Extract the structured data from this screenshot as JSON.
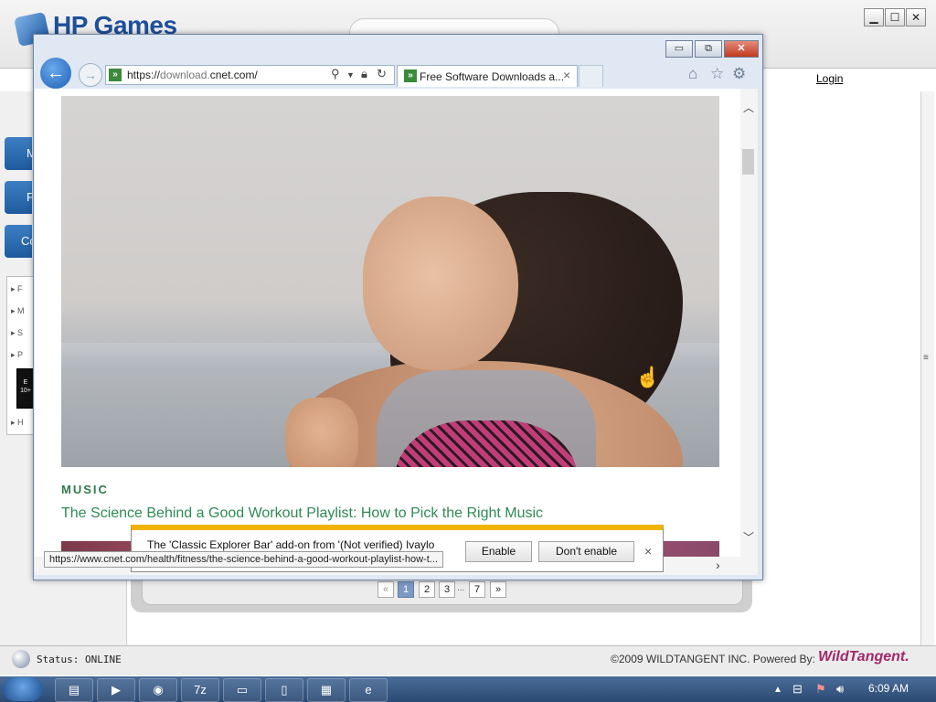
{
  "hp_window": {
    "logo_text": "HP Games",
    "login_label": "Login",
    "window_min": "▁",
    "window_max": "☐",
    "window_close": "✕",
    "nav_tabs": [
      "M",
      "F",
      "Co"
    ],
    "left_list_items": [
      "▸ F",
      "▸ M",
      "▸ S",
      "▸ P",
      "▸ H"
    ],
    "esrb_label": "E 10+",
    "pagination": {
      "prev": "«",
      "pages": [
        "1",
        "2",
        "3"
      ],
      "ellipsis": "...",
      "last": "7",
      "next": "»",
      "active": "1"
    },
    "status_text": "Status: ONLINE",
    "copyright": "©2009 WILDTANGENT INC. Powered By:",
    "brand": "WildTangent."
  },
  "ie_window": {
    "buttons": {
      "minimize": "▭",
      "restore": "⧉",
      "close": "✕"
    },
    "back_icon": "←",
    "forward_icon": "→",
    "address_url_host": "https://",
    "address_url_dim": "download.",
    "address_url_main": "cnet.com/",
    "favicon": "»",
    "tab_title": "Free Software Downloads a...",
    "tab_close": "×",
    "tool_icons": [
      "home-icon",
      "star-icon",
      "gear-icon"
    ],
    "content": {
      "category": "MUSIC",
      "article_title": "The Science Behind a Good Workout Playlist: How to Pick the Right Music"
    },
    "notification": {
      "text": "The 'Classic Explorer Bar' add-on from '(Not verified) Ivaylo",
      "enable_label": "Enable",
      "dont_enable_label": "Don't enable",
      "close": "×"
    },
    "status_link": "https://www.cnet.com/health/fitness/the-science-behind-a-good-workout-playlist-how-t..."
  },
  "taskbar": {
    "clock": "6:09 AM",
    "apps": [
      "explorer",
      "media-player",
      "chrome",
      "7zip",
      "network",
      "notepad",
      "hp-games",
      "internet-explorer"
    ]
  },
  "colors": {
    "accent_green": "#2f8a55",
    "notif_bar": "#f0b400",
    "wt_brand": "#a0296a"
  }
}
